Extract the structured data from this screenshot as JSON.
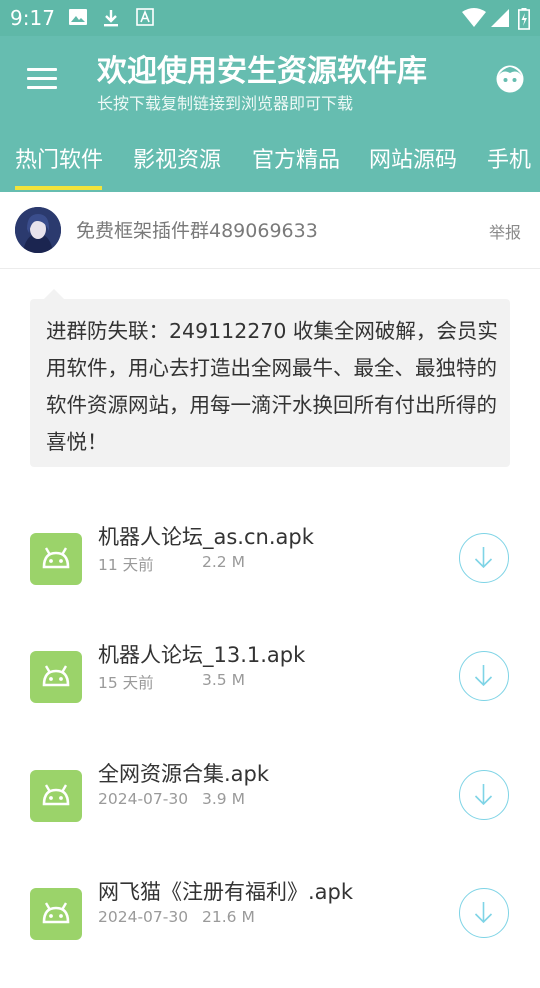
{
  "status_bar": {
    "time": "9:17",
    "icons": [
      "image-icon",
      "download-icon",
      "a-icon",
      "wifi-icon",
      "signal-icon",
      "battery-icon"
    ]
  },
  "header": {
    "title": "欢迎使用安生资源软件库",
    "subtitle": "长按下载复制链接到浏览器即可下载",
    "background": "#66bdb0",
    "tabs": [
      "热门软件",
      "影视资源",
      "官方精品",
      "网站源码",
      "手机"
    ],
    "active_tab_index": 0,
    "indicator_color": "#f2e43a"
  },
  "post": {
    "author": "免费框架插件群489069633",
    "report_label": "举报",
    "text": "进群防失联：249112270 收集全网破解，会员实用软件，用心去打造出全网最牛、最全、最独特的软件资源网站，用每一滴汗水换回所有付出所得的喜悦！"
  },
  "files": [
    {
      "name": "机器人论坛_as.cn.apk",
      "time": "11 天前",
      "size": "2.2 M"
    },
    {
      "name": "机器人论坛_13.1.apk",
      "time": "15 天前",
      "size": "3.5 M"
    },
    {
      "name": "全网资源合集.apk",
      "time": "2024-07-30",
      "size": "3.9 M"
    },
    {
      "name": "网飞猫《注册有福利》.apk",
      "time": "2024-07-30",
      "size": "21.6 M"
    }
  ]
}
